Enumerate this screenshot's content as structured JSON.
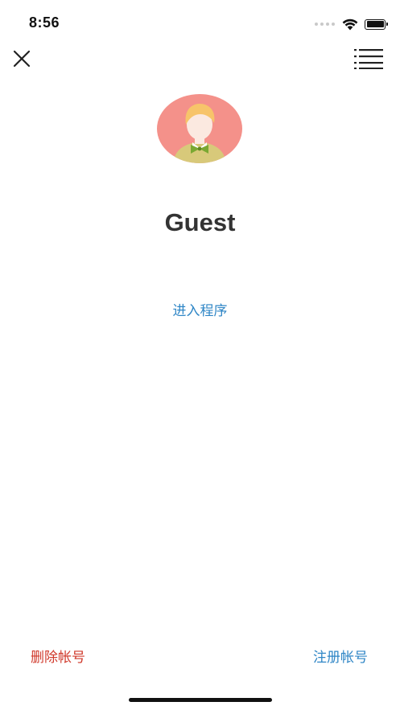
{
  "status_bar": {
    "time": "8:56",
    "icons": [
      "signal-dots-icon",
      "wifi-icon",
      "battery-icon"
    ]
  },
  "navbar": {
    "close_icon": "close-icon",
    "menu_icon": "list-menu-icon"
  },
  "profile": {
    "avatar_icon": "guest-avatar-icon",
    "avatar_colors": {
      "background": "#f4918a",
      "hair": "#f7c46a",
      "face": "#fbe9e0",
      "body": "#d8c97a",
      "bowtie": "#7aa832"
    },
    "username": "Guest"
  },
  "actions": {
    "enter_program": "进入程序",
    "delete_account": "删除帐号",
    "register_account": "注册帐号"
  },
  "colors": {
    "link_blue": "#2f86c6",
    "danger_red": "#d0392b",
    "title_text": "#333333"
  }
}
